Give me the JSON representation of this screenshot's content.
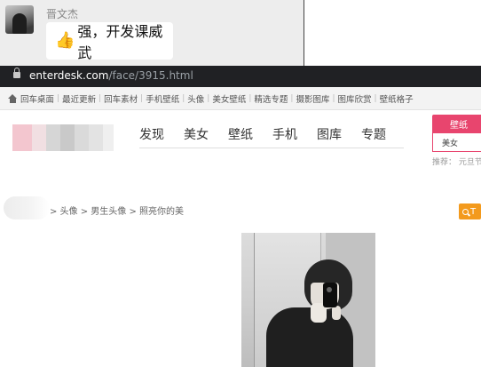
{
  "chat": {
    "sender_name": "晋文杰",
    "thumbs_emoji": "👍",
    "message": "强，开发课威武"
  },
  "browser": {
    "url_host": "enterdesk.com",
    "url_path": "/face/3915.html"
  },
  "site": {
    "top_links": [
      "回车桌面",
      "最近更新",
      "回车素材",
      "手机壁纸",
      "头像",
      "美女壁纸",
      "精选专题",
      "摄影图库",
      "图库欣赏",
      "壁纸格子"
    ],
    "nav": [
      "发现",
      "美女",
      "壁纸",
      "手机",
      "图库",
      "专题"
    ],
    "search_tab": "壁纸",
    "search_value": "美女",
    "recommend": "推荐：  元旦节",
    "breadcrumb": "> 头像 > 男生头像 > 照亮你的美",
    "search_button_label": "T"
  },
  "colors": {
    "accent_pink": "#e8456e",
    "accent_orange": "#f39a1d",
    "address_bar": "#202124"
  }
}
